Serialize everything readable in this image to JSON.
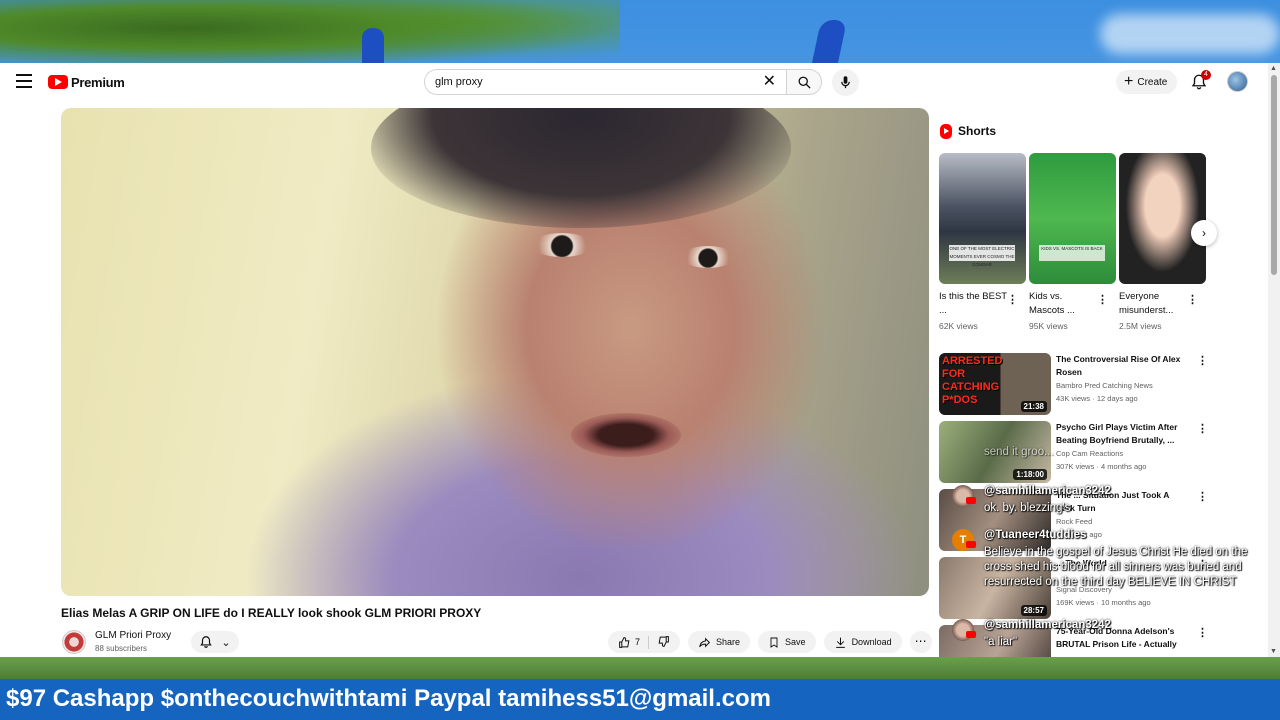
{
  "masthead": {
    "logo_text": "Premium",
    "search_value": "glm proxy",
    "create_label": "Create",
    "notification_count": "4"
  },
  "video": {
    "title": "Elias Melas A GRIP ON LIFE do I REALLY look shook GLM PRIORI PROXY",
    "channel_name": "GLM Priori Proxy",
    "subscribers": "88 subscribers",
    "like_count": "7",
    "share_label": "Share",
    "save_label": "Save",
    "download_label": "Download"
  },
  "shorts": {
    "heading": "Shorts",
    "items": [
      {
        "title": "Is this the BEST ...",
        "views": "62K views",
        "thumb_text": "ONE OF THE MOST ELECTRIC MOMENTS EVER COSMO THE COUGAR"
      },
      {
        "title": "Kids vs. Mascots ...",
        "views": "95K views",
        "thumb_text": "KIDS VS. MASCOTS IS BACK"
      },
      {
        "title": "Everyone misunderst...",
        "views": "2.5M views",
        "thumb_text": ""
      }
    ]
  },
  "recommendations": [
    {
      "title": "The Controversial Rise Of Alex Rosen",
      "channel": "Bambro Pred Catching News",
      "meta": "43K views · 12 days ago",
      "duration": "21:38",
      "thumb_text": "ARRESTED FOR CATCHING P*DOS"
    },
    {
      "title": "Psycho Girl Plays Victim After Beating Boyfriend Brutally, ...",
      "channel": "Cop Cam Reactions",
      "meta": "307K views · 4 months ago",
      "duration": "1:18:00",
      "thumb_text": ""
    },
    {
      "title": "The ... Situation Just Took A Dark Turn",
      "channel": "Rock Feed",
      "meta": "... · 1 day ago",
      "duration": "",
      "thumb_text": ""
    },
    {
      "title": "... The World",
      "channel": "Signal Discovery",
      "meta": "169K views · 10 months ago",
      "duration": "28:57",
      "thumb_text": ""
    },
    {
      "title": "75-Year-Old Donna Adelson's BRUTAL Prison Life - Actually ...",
      "channel": "",
      "meta": "",
      "duration": "",
      "thumb_text": ""
    }
  ],
  "chat": [
    {
      "user": "@samhillamerican3242",
      "text": "send it groo..."
    },
    {
      "user": "@samhillamerican3242",
      "text": "ok. by. blezzing's"
    },
    {
      "user": "@Tuaneer4tuddies",
      "avatar_letter": "T",
      "text": "Believe in the gospel of Jesus Christ He died on the cross shed his blood for all sinners was buried and resurrected on the third day BELIEVE IN CHRIST"
    },
    {
      "user": "@samhillamerican3242",
      "text": "\"a liar\""
    }
  ],
  "banner": {
    "text": "$97 Cashapp $onthecouchwithtami Paypal tamihess51@gmail.com"
  },
  "colors": {
    "youtube_red": "#ff0000",
    "banner_blue": "#1565c0"
  }
}
